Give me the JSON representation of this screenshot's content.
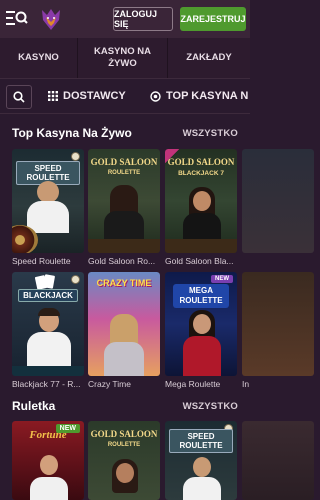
{
  "header": {
    "login_label": "ZALOGUJ SIĘ",
    "register_label": "ZAREJESTRUJ",
    "logo_icon": "wolf-logo-icon",
    "menu_icon": "menu-search-icon"
  },
  "nav": {
    "tabs": [
      {
        "label": "KASYNO"
      },
      {
        "label": "KASYNO NA ŻYWO"
      },
      {
        "label": "ZAKŁADY"
      }
    ]
  },
  "filters": {
    "search_icon": "search-icon",
    "providers_label": "DOSTAWCY",
    "top_label": "TOP KASYNA N"
  },
  "sections": [
    {
      "title": "Top Kasyna Na Żywo",
      "all_label": "WSZYSTKO",
      "games": [
        {
          "name": "Speed Roulette",
          "logo": "SPEED ROULETTE"
        },
        {
          "name": "Gold Saloon Ro...",
          "logo": "GOLD SALOON",
          "sub": "ROULETTE"
        },
        {
          "name": "Gold Saloon Bla...",
          "logo": "GOLD SALOON",
          "sub": "BLACKJACK 7"
        },
        {
          "name": "",
          "logo": ""
        },
        {
          "name": "Blackjack 77 - R...",
          "logo": "BLACKJACK"
        },
        {
          "name": "Crazy Time",
          "logo": "CRAZY TIME"
        },
        {
          "name": "Mega Roulette",
          "logo": "MEGA ROULETTE"
        },
        {
          "name": "In",
          "logo": ""
        }
      ]
    },
    {
      "title": "Ruletka",
      "all_label": "WSZYSTKO",
      "games": [
        {
          "name": "",
          "logo": "Fortune",
          "badge": "NEW"
        },
        {
          "name": "",
          "logo": "GOLD SALOON",
          "sub": "ROULETTE"
        },
        {
          "name": "",
          "logo": "SPEED ROULETTE"
        },
        {
          "name": "",
          "logo": ""
        }
      ]
    }
  ],
  "colors": {
    "background": "#2a1a2e",
    "topbar": "#3a2538",
    "register": "#4f9a2e",
    "accent_purple": "#7c3f8e"
  }
}
